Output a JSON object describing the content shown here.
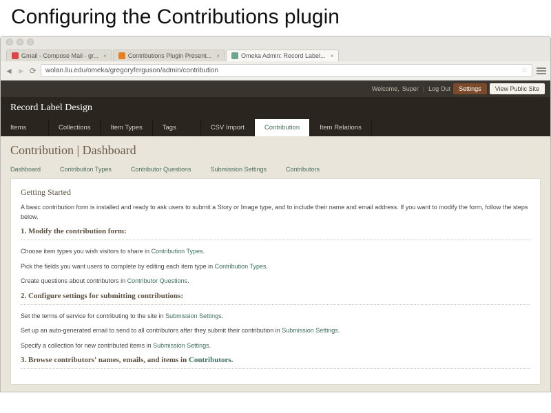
{
  "slide": {
    "title": "Configuring the Contributions plugin"
  },
  "tabs": {
    "t0": "Gmail - Compose Mail - gr...",
    "t1": "Contributions Plugin Present...",
    "t2": "Omeka Admin: Record Label..."
  },
  "url": "wolan.liu.edu/omeka/gregoryferguson/admin/contribution",
  "topbar": {
    "welcome": "Welcome,",
    "user": "Super",
    "logout": "Log Out",
    "settings": "Settings",
    "public": "View Public Site"
  },
  "site": {
    "title": "Record Label Design"
  },
  "nav": {
    "items": "Items",
    "collections": "Collections",
    "itemtypes": "Item Types",
    "tags": "Tags",
    "csv": "CSV Import",
    "contribution": "Contribution",
    "relations": "Item Relations"
  },
  "page": {
    "title": "Contribution | Dashboard"
  },
  "subnav": {
    "dashboard": "Dashboard",
    "types": "Contribution Types",
    "questions": "Contributor Questions",
    "submission": "Submission Settings",
    "contributors": "Contributors"
  },
  "body": {
    "started": "Getting Started",
    "intro": "A basic contribution form is installed and ready to ask users to submit a Story or Image type, and to include their name and email address. If you want to modify the form, follow the steps below.",
    "h1": "1. Modify the contribution form:",
    "l1a_pre": "Choose item types you wish visitors to share in ",
    "l1a_link": "Contribution Types",
    "l1b_pre": "Pick the fields you want users to complete by editing each item type in ",
    "l1b_link": "Contribution Types",
    "l1c_pre": "Create questions about contributors in ",
    "l1c_link": "Contributor Questions",
    "h2": "2. Configure settings for submitting contributions:",
    "l2a_pre": "Set the terms of service for contributing to the site in ",
    "l2a_link": "Submission Settings",
    "l2b_pre": "Set up an auto-generated email to send to all contributors after they submit their contribution in ",
    "l2b_link": "Submission Settings",
    "l2c_pre": "Specify a collection for new contributed items in ",
    "l2c_link": "Submission Settings",
    "h3_pre": "3. Browse contributors' names, emails, and items in ",
    "h3_link": "Contributors",
    "period": "."
  }
}
